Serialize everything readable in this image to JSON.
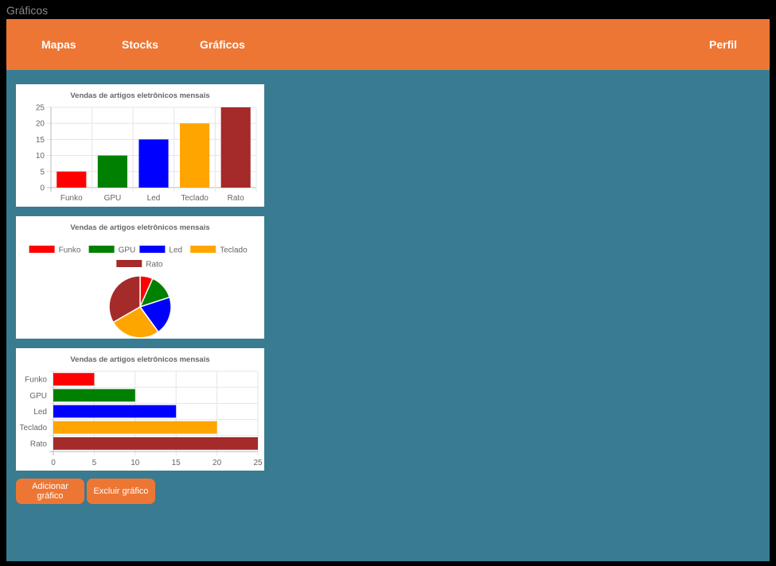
{
  "window": {
    "title": "Gráficos"
  },
  "navbar": {
    "items": [
      {
        "label": "Mapas"
      },
      {
        "label": "Stocks"
      },
      {
        "label": "Gráficos"
      }
    ],
    "profile_label": "Perfil"
  },
  "colors": {
    "accent": "#ED7634",
    "background": "#397B91"
  },
  "actions": {
    "add_label": "Adicionar gráfico",
    "delete_label": "Excluir gráfico"
  },
  "chart_data": [
    {
      "type": "bar",
      "title": "Vendas de artigos eletrônicos mensais",
      "categories": [
        "Funko",
        "GPU",
        "Led",
        "Teclado",
        "Rato"
      ],
      "values": [
        5,
        10,
        15,
        20,
        25
      ],
      "colors": [
        "#FF0000",
        "#008000",
        "#0000FF",
        "#FFA500",
        "#A52A2A"
      ],
      "ylim": [
        0,
        25
      ],
      "yticks": [
        0,
        5,
        10,
        15,
        20,
        25
      ],
      "grid": true
    },
    {
      "type": "pie",
      "title": "Vendas de artigos eletrônicos mensais",
      "categories": [
        "Funko",
        "GPU",
        "Led",
        "Teclado",
        "Rato"
      ],
      "values": [
        5,
        10,
        15,
        20,
        25
      ],
      "colors": [
        "#FF0000",
        "#008000",
        "#0000FF",
        "#FFA500",
        "#A52A2A"
      ],
      "legend": "top"
    },
    {
      "type": "bar",
      "orientation": "horizontal",
      "title": "Vendas de artigos eletrônicos mensais",
      "categories": [
        "Funko",
        "GPU",
        "Led",
        "Teclado",
        "Rato"
      ],
      "values": [
        5,
        10,
        15,
        20,
        25
      ],
      "colors": [
        "#FF0000",
        "#008000",
        "#0000FF",
        "#FFA500",
        "#A52A2A"
      ],
      "xlim": [
        0,
        25
      ],
      "xticks": [
        0,
        5,
        10,
        15,
        20,
        25
      ],
      "grid": true
    }
  ]
}
